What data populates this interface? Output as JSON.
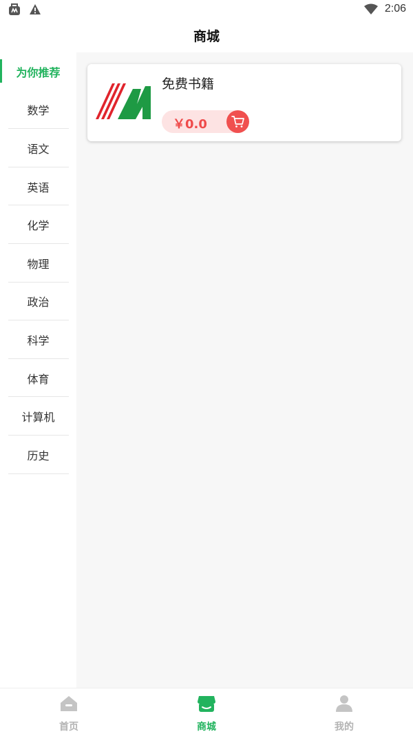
{
  "status_bar": {
    "time": "2:06"
  },
  "header": {
    "title": "商城"
  },
  "sidebar": {
    "items": [
      {
        "label": "为你推荐",
        "active": true
      },
      {
        "label": "数学"
      },
      {
        "label": "语文"
      },
      {
        "label": "英语"
      },
      {
        "label": "化学"
      },
      {
        "label": "物理"
      },
      {
        "label": "政治"
      },
      {
        "label": "科学"
      },
      {
        "label": "体育"
      },
      {
        "label": "计算机"
      },
      {
        "label": "历史"
      }
    ]
  },
  "products": [
    {
      "title": "免费书籍",
      "price": "￥0.0",
      "logo_icon": "publisher-logo",
      "cart_icon": "shopping-cart-icon"
    }
  ],
  "tabbar": {
    "tabs": [
      {
        "label": "首页",
        "icon": "home-icon"
      },
      {
        "label": "商城",
        "icon": "store-icon",
        "active": true
      },
      {
        "label": "我的",
        "icon": "user-icon"
      }
    ]
  },
  "colors": {
    "accent": "#22b35e",
    "price": "#ef4b4b",
    "price_bg": "#fde3e3",
    "cart": "#f0504f",
    "logo_red": "#e0242c",
    "logo_green": "#1e9a44"
  }
}
